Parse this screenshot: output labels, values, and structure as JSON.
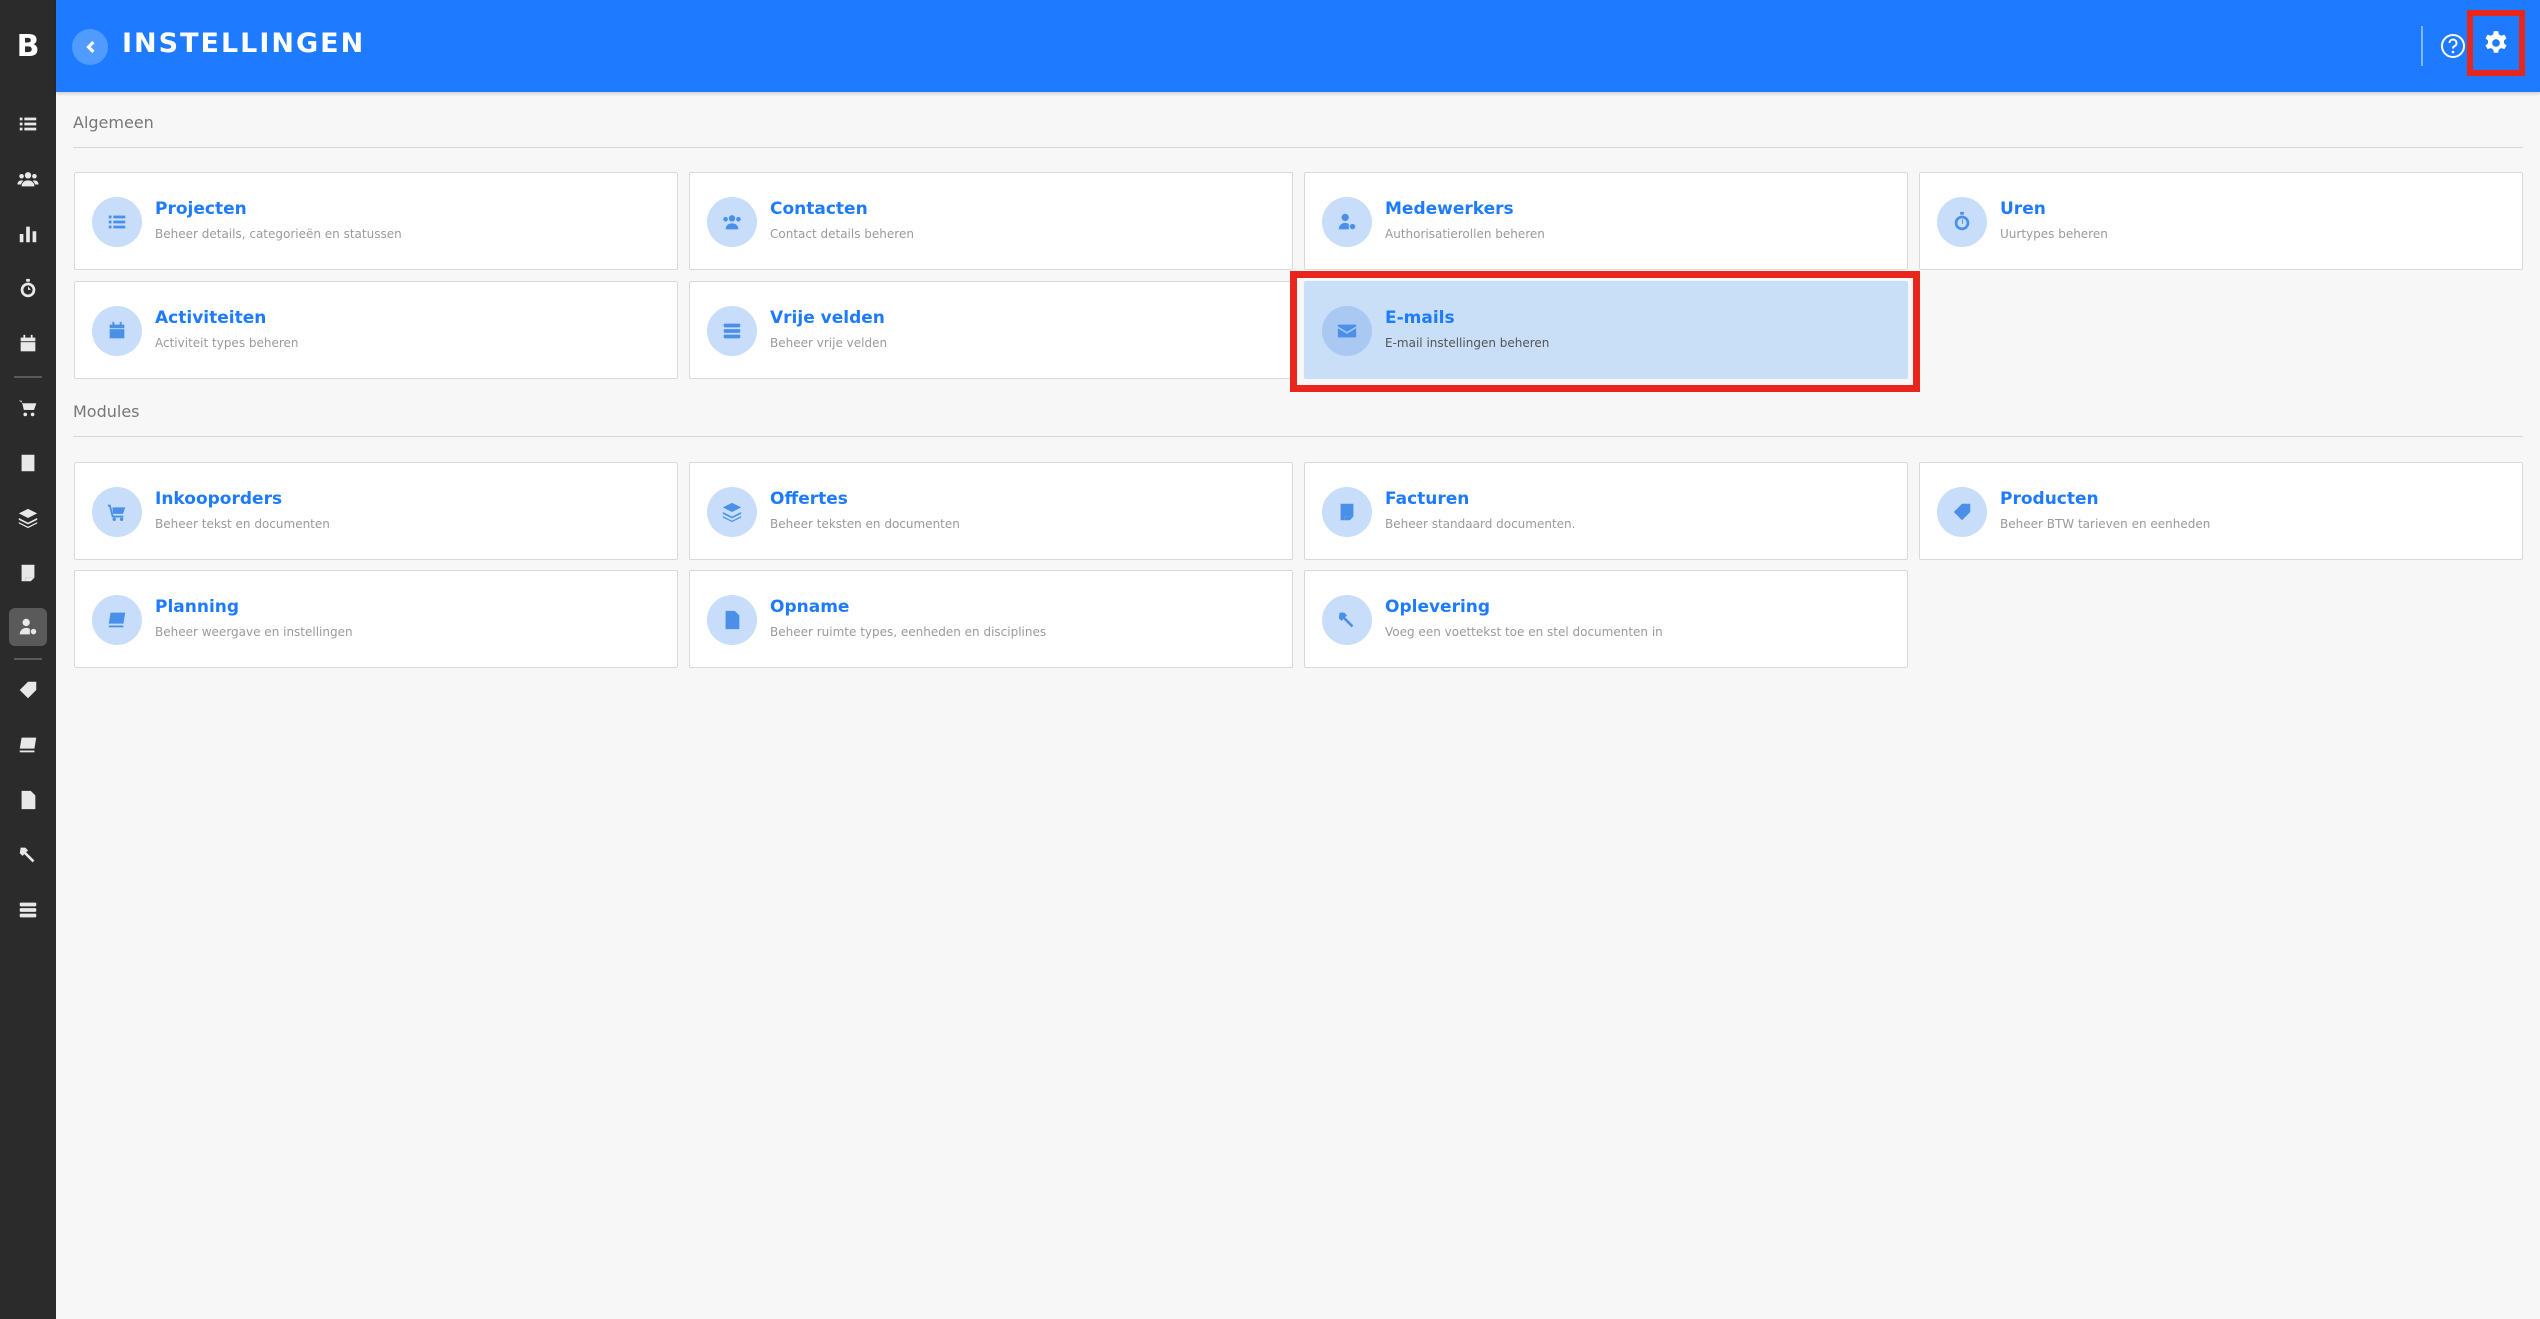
{
  "app": {
    "logo_letter": "B"
  },
  "header": {
    "title": "INSTELLINGEN"
  },
  "sections": {
    "general": "Algemeen",
    "modules": "Modules"
  },
  "cards": {
    "projecten": {
      "title": "Projecten",
      "sub": "Beheer details, categorieën en statussen",
      "icon": "list-icon"
    },
    "contacten": {
      "title": "Contacten",
      "sub": "Contact details beheren",
      "icon": "users-icon"
    },
    "medewerkers": {
      "title": "Medewerkers",
      "sub": "Authorisatierollen beheren",
      "icon": "user-key-icon"
    },
    "uren": {
      "title": "Uren",
      "sub": "Uurtypes beheren",
      "icon": "stopwatch-icon"
    },
    "activiteiten": {
      "title": "Activiteiten",
      "sub": "Activiteit types beheren",
      "icon": "calendar-icon"
    },
    "vrije_velden": {
      "title": "Vrije velden",
      "sub": "Beheer vrije velden",
      "icon": "fields-icon"
    },
    "emails": {
      "title": "E-mails",
      "sub": "E-mail instellingen beheren",
      "icon": "envelope-icon"
    },
    "inkooporders": {
      "title": "Inkooporders",
      "sub": "Beheer tekst en documenten",
      "icon": "cart-icon"
    },
    "offertes": {
      "title": "Offertes",
      "sub": "Beheer teksten en documenten",
      "icon": "layers-icon"
    },
    "facturen": {
      "title": "Facturen",
      "sub": "Beheer standaard documenten.",
      "icon": "invoice-icon"
    },
    "producten": {
      "title": "Producten",
      "sub": "Beheer BTW tarieven en eenheden",
      "icon": "tag-icon"
    },
    "planning": {
      "title": "Planning",
      "sub": "Beheer weergave en instellingen",
      "icon": "planning-icon"
    },
    "opname": {
      "title": "Opname",
      "sub": "Beheer ruimte types, eenheden en disciplines",
      "icon": "file-plus-icon"
    },
    "oplevering": {
      "title": "Oplevering",
      "sub": "Voeg een voettekst toe en stel documenten in",
      "icon": "tools-icon"
    }
  },
  "colors": {
    "header": "#1e7bff",
    "sidebar": "#2b2b2b",
    "highlight": "#e8261c",
    "selected_card": "#c9def7"
  }
}
